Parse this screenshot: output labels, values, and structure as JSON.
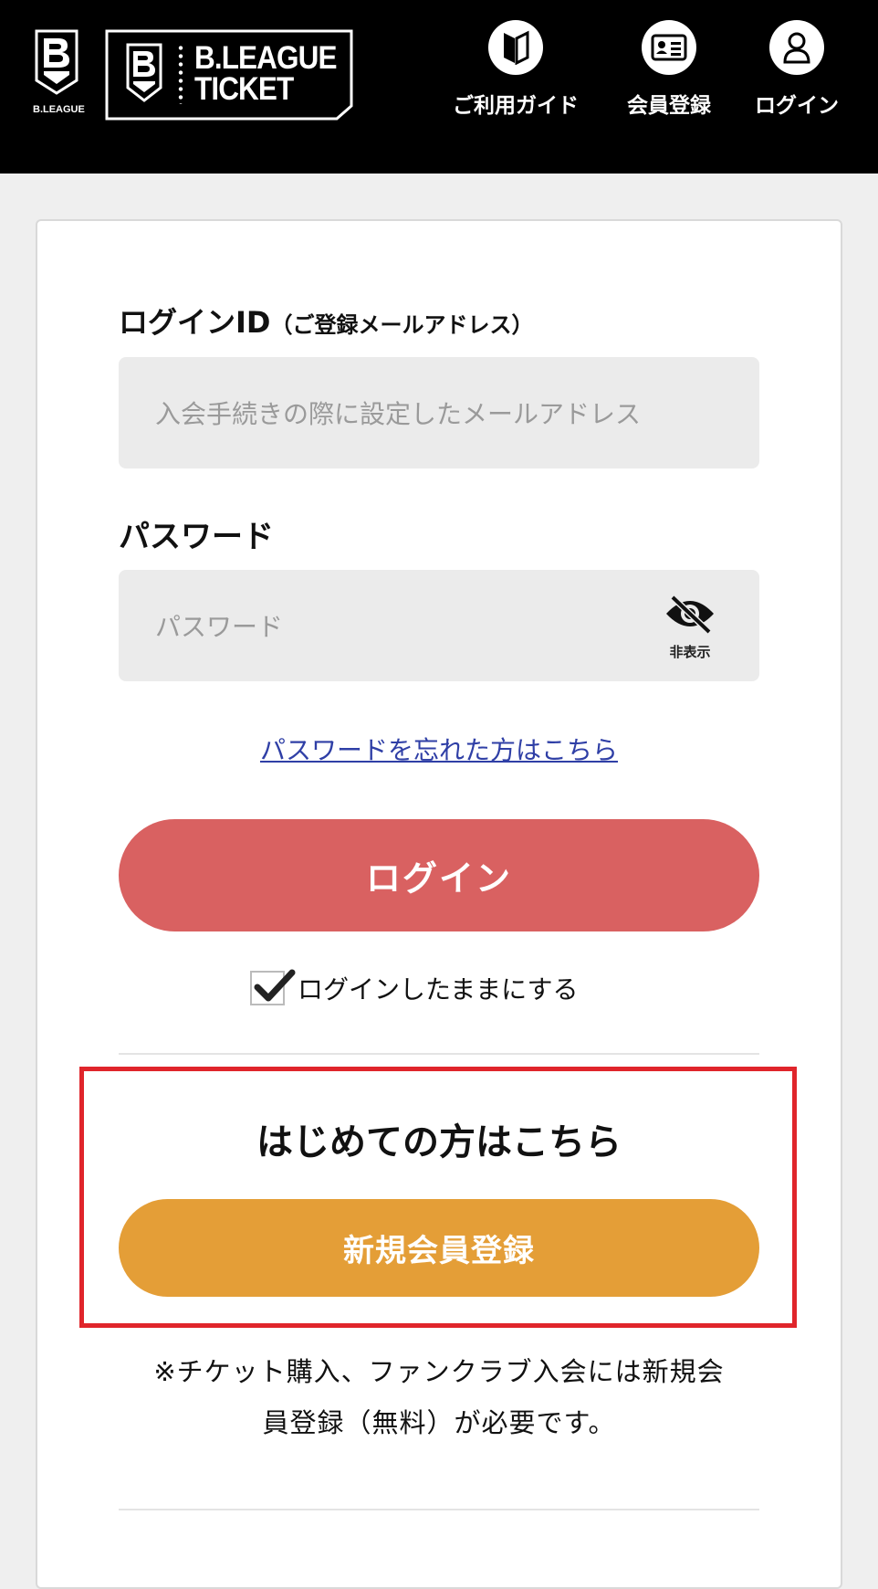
{
  "header": {
    "brand_small": "B.LEAGUE",
    "ticket_logo_line1": "B.LEAGUE",
    "ticket_logo_line2": "TICKET",
    "nav": [
      {
        "label": "ご利用ガイド",
        "icon": "guide-icon"
      },
      {
        "label": "会員登録",
        "icon": "member-card-icon"
      },
      {
        "label": "ログイン",
        "icon": "user-icon"
      }
    ]
  },
  "login_form": {
    "id_label": "ログインID",
    "id_label_sub": "（ご登録メールアドレス）",
    "id_placeholder": "入会手続きの際に設定したメールアドレス",
    "password_label": "パスワード",
    "password_placeholder": "パスワード",
    "password_toggle_label": "非表示",
    "forgot_link": "パスワードを忘れた方はこちら",
    "login_button": "ログイン",
    "remember_label": "ログインしたままにする",
    "remember_checked": true
  },
  "first_time": {
    "title": "はじめての方はこちら",
    "register_button": "新規会員登録",
    "note_line1": "※チケット購入、ファンクラブ入会には新規会",
    "note_line2": "員登録（無料）が必要です。"
  },
  "colors": {
    "header_bg": "#000000",
    "login_button": "#d96161",
    "register_button": "#e49e37",
    "highlight_border": "#e0252b",
    "link": "#2f3fa6"
  }
}
